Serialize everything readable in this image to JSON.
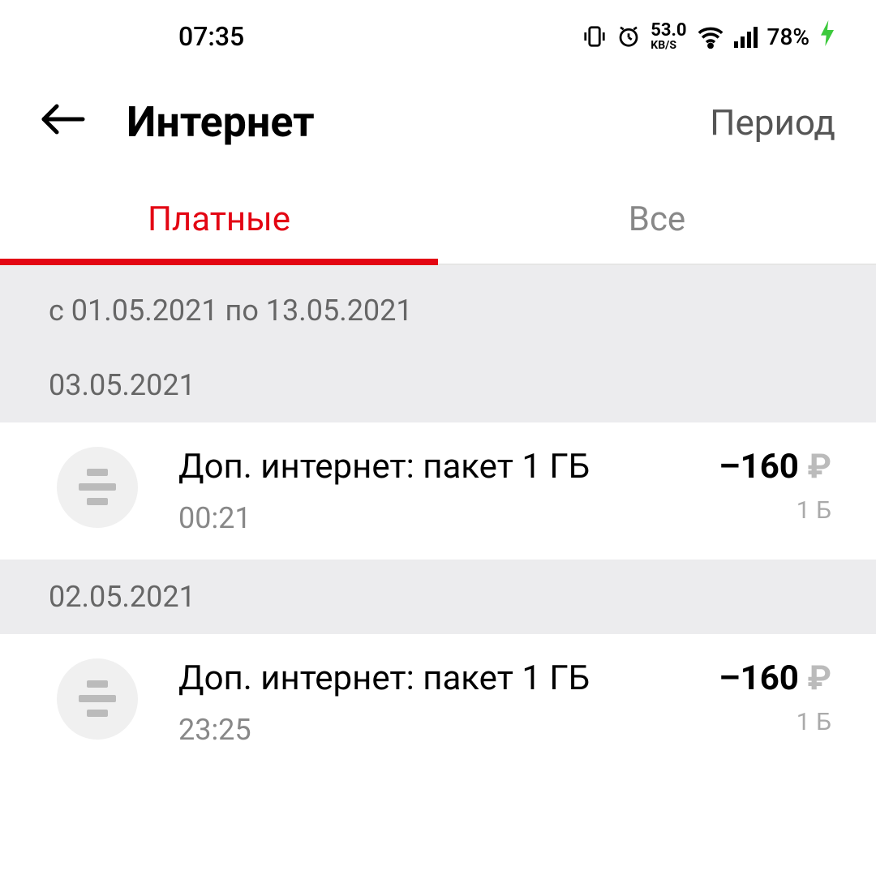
{
  "status": {
    "time": "07:35",
    "kbs_value": "53.0",
    "kbs_label": "KB/S",
    "battery": "78%"
  },
  "header": {
    "title": "Интернет",
    "period": "Период"
  },
  "tabs": {
    "paid": "Платные",
    "all": "Все"
  },
  "range": {
    "text": "с 01.05.2021 по 13.05.2021"
  },
  "days": [
    {
      "date": "03.05.2021",
      "items": [
        {
          "title": "Доп. интернет: пакет 1 ГБ",
          "time": "00:21",
          "amount": "–160",
          "currency": "₽",
          "sub": "1 Б"
        }
      ]
    },
    {
      "date": "02.05.2021",
      "items": [
        {
          "title": "Доп. интернет: пакет 1 ГБ",
          "time": "23:25",
          "amount": "–160",
          "currency": "₽",
          "sub": "1 Б"
        }
      ]
    }
  ]
}
